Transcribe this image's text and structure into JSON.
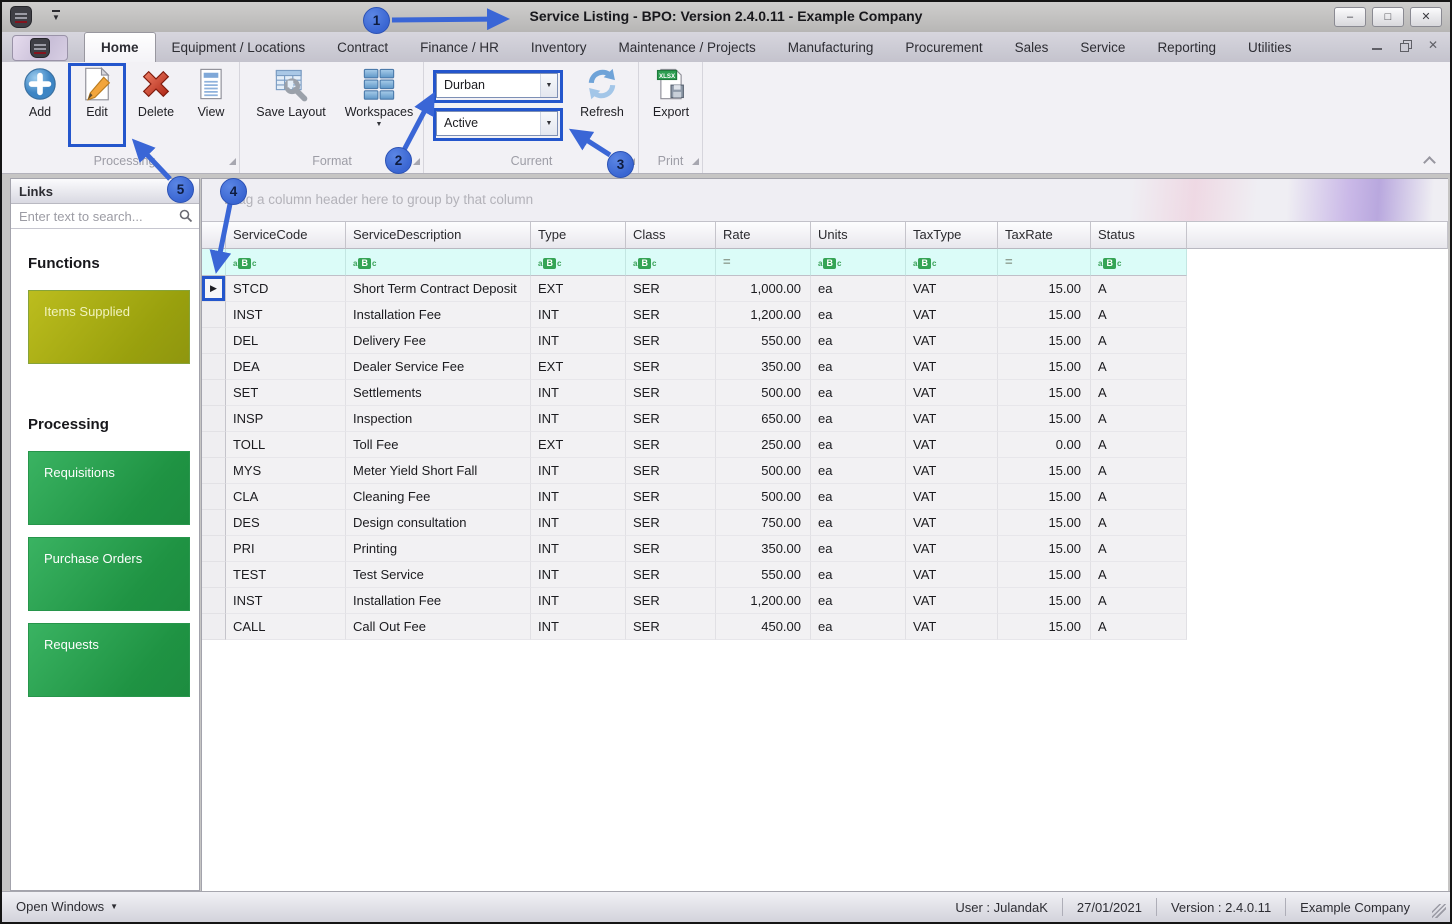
{
  "window": {
    "title": "Service Listing - BPO: Version 2.4.0.11 - Example Company"
  },
  "tabs": {
    "active": "Home",
    "items": [
      "Home",
      "Equipment / Locations",
      "Contract",
      "Finance / HR",
      "Inventory",
      "Maintenance / Projects",
      "Manufacturing",
      "Procurement",
      "Sales",
      "Service",
      "Reporting",
      "Utilities"
    ]
  },
  "ribbon": {
    "buttons": {
      "add": "Add",
      "edit": "Edit",
      "delete": "Delete",
      "view": "View",
      "save_layout": "Save Layout",
      "workspaces": "Workspaces",
      "refresh": "Refresh",
      "export": "Export"
    },
    "combos": {
      "site": "Durban",
      "status": "Active"
    },
    "groups": {
      "processing": "Processing",
      "format": "Format",
      "current": "Current",
      "print": "Print"
    }
  },
  "sidebar": {
    "links_title": "Links",
    "search_placeholder": "Enter text to search...",
    "sections": [
      {
        "heading": "Functions",
        "style": "olive",
        "items": [
          "Items Supplied"
        ]
      },
      {
        "heading": "Processing",
        "style": "green",
        "items": [
          "Requisitions",
          "Purchase Orders",
          "Requests"
        ]
      }
    ]
  },
  "grid": {
    "group_panel_text": "Drag a column header here to group by that column",
    "columns": [
      {
        "label": "ServiceCode",
        "filter": "abc"
      },
      {
        "label": "ServiceDescription",
        "filter": "abc"
      },
      {
        "label": "Type",
        "filter": "abc"
      },
      {
        "label": "Class",
        "filter": "abc"
      },
      {
        "label": "Rate",
        "filter": "eq"
      },
      {
        "label": "Units",
        "filter": "abc"
      },
      {
        "label": "TaxType",
        "filter": "abc"
      },
      {
        "label": "TaxRate",
        "filter": "eq"
      },
      {
        "label": "Status",
        "filter": "abc"
      }
    ],
    "rows": [
      [
        "STCD",
        "Short Term Contract Deposit",
        "EXT",
        "SER",
        "1,000.00",
        "ea",
        "VAT",
        "15.00",
        "A"
      ],
      [
        "INST",
        "Installation Fee",
        "INT",
        "SER",
        "1,200.00",
        "ea",
        "VAT",
        "15.00",
        "A"
      ],
      [
        "DEL",
        "Delivery Fee",
        "INT",
        "SER",
        "550.00",
        "ea",
        "VAT",
        "15.00",
        "A"
      ],
      [
        "DEA",
        "Dealer Service Fee",
        "EXT",
        "SER",
        "350.00",
        "ea",
        "VAT",
        "15.00",
        "A"
      ],
      [
        "SET",
        "Settlements",
        "INT",
        "SER",
        "500.00",
        "ea",
        "VAT",
        "15.00",
        "A"
      ],
      [
        "INSP",
        "Inspection",
        "INT",
        "SER",
        "650.00",
        "ea",
        "VAT",
        "15.00",
        "A"
      ],
      [
        "TOLL",
        "Toll Fee",
        "EXT",
        "SER",
        "250.00",
        "ea",
        "VAT",
        "0.00",
        "A"
      ],
      [
        "MYS",
        "Meter Yield Short Fall",
        "INT",
        "SER",
        "500.00",
        "ea",
        "VAT",
        "15.00",
        "A"
      ],
      [
        "CLA",
        "Cleaning Fee",
        "INT",
        "SER",
        "500.00",
        "ea",
        "VAT",
        "15.00",
        "A"
      ],
      [
        "DES",
        "Design consultation",
        "INT",
        "SER",
        "750.00",
        "ea",
        "VAT",
        "15.00",
        "A"
      ],
      [
        "PRI",
        "Printing",
        "INT",
        "SER",
        "350.00",
        "ea",
        "VAT",
        "15.00",
        "A"
      ],
      [
        "TEST",
        "Test Service",
        "INT",
        "SER",
        "550.00",
        "ea",
        "VAT",
        "15.00",
        "A"
      ],
      [
        "INST",
        "Installation Fee",
        "INT",
        "SER",
        "1,200.00",
        "ea",
        "VAT",
        "15.00",
        "A"
      ],
      [
        "CALL",
        "Call Out Fee",
        "INT",
        "SER",
        "450.00",
        "ea",
        "VAT",
        "15.00",
        "A"
      ]
    ]
  },
  "statusbar": {
    "open_windows": "Open Windows",
    "segments": [
      "User : JulandaK",
      "27/01/2021",
      "Version : 2.4.0.11",
      "Example Company"
    ]
  },
  "callouts": {
    "c1": "1",
    "c2": "2",
    "c3": "3",
    "c4": "4",
    "c5": "5"
  },
  "icons": {
    "dropdown": "▼",
    "row_marker": "▶",
    "minimize": "–",
    "maximize": "□",
    "close": "✕"
  },
  "colors": {
    "accent_blue": "#3a66d6",
    "highlight_border": "#2456cc",
    "green_button": "#23a04c",
    "olive_button": "#a3a811",
    "filter_row_bg": "#dbfcf8"
  }
}
